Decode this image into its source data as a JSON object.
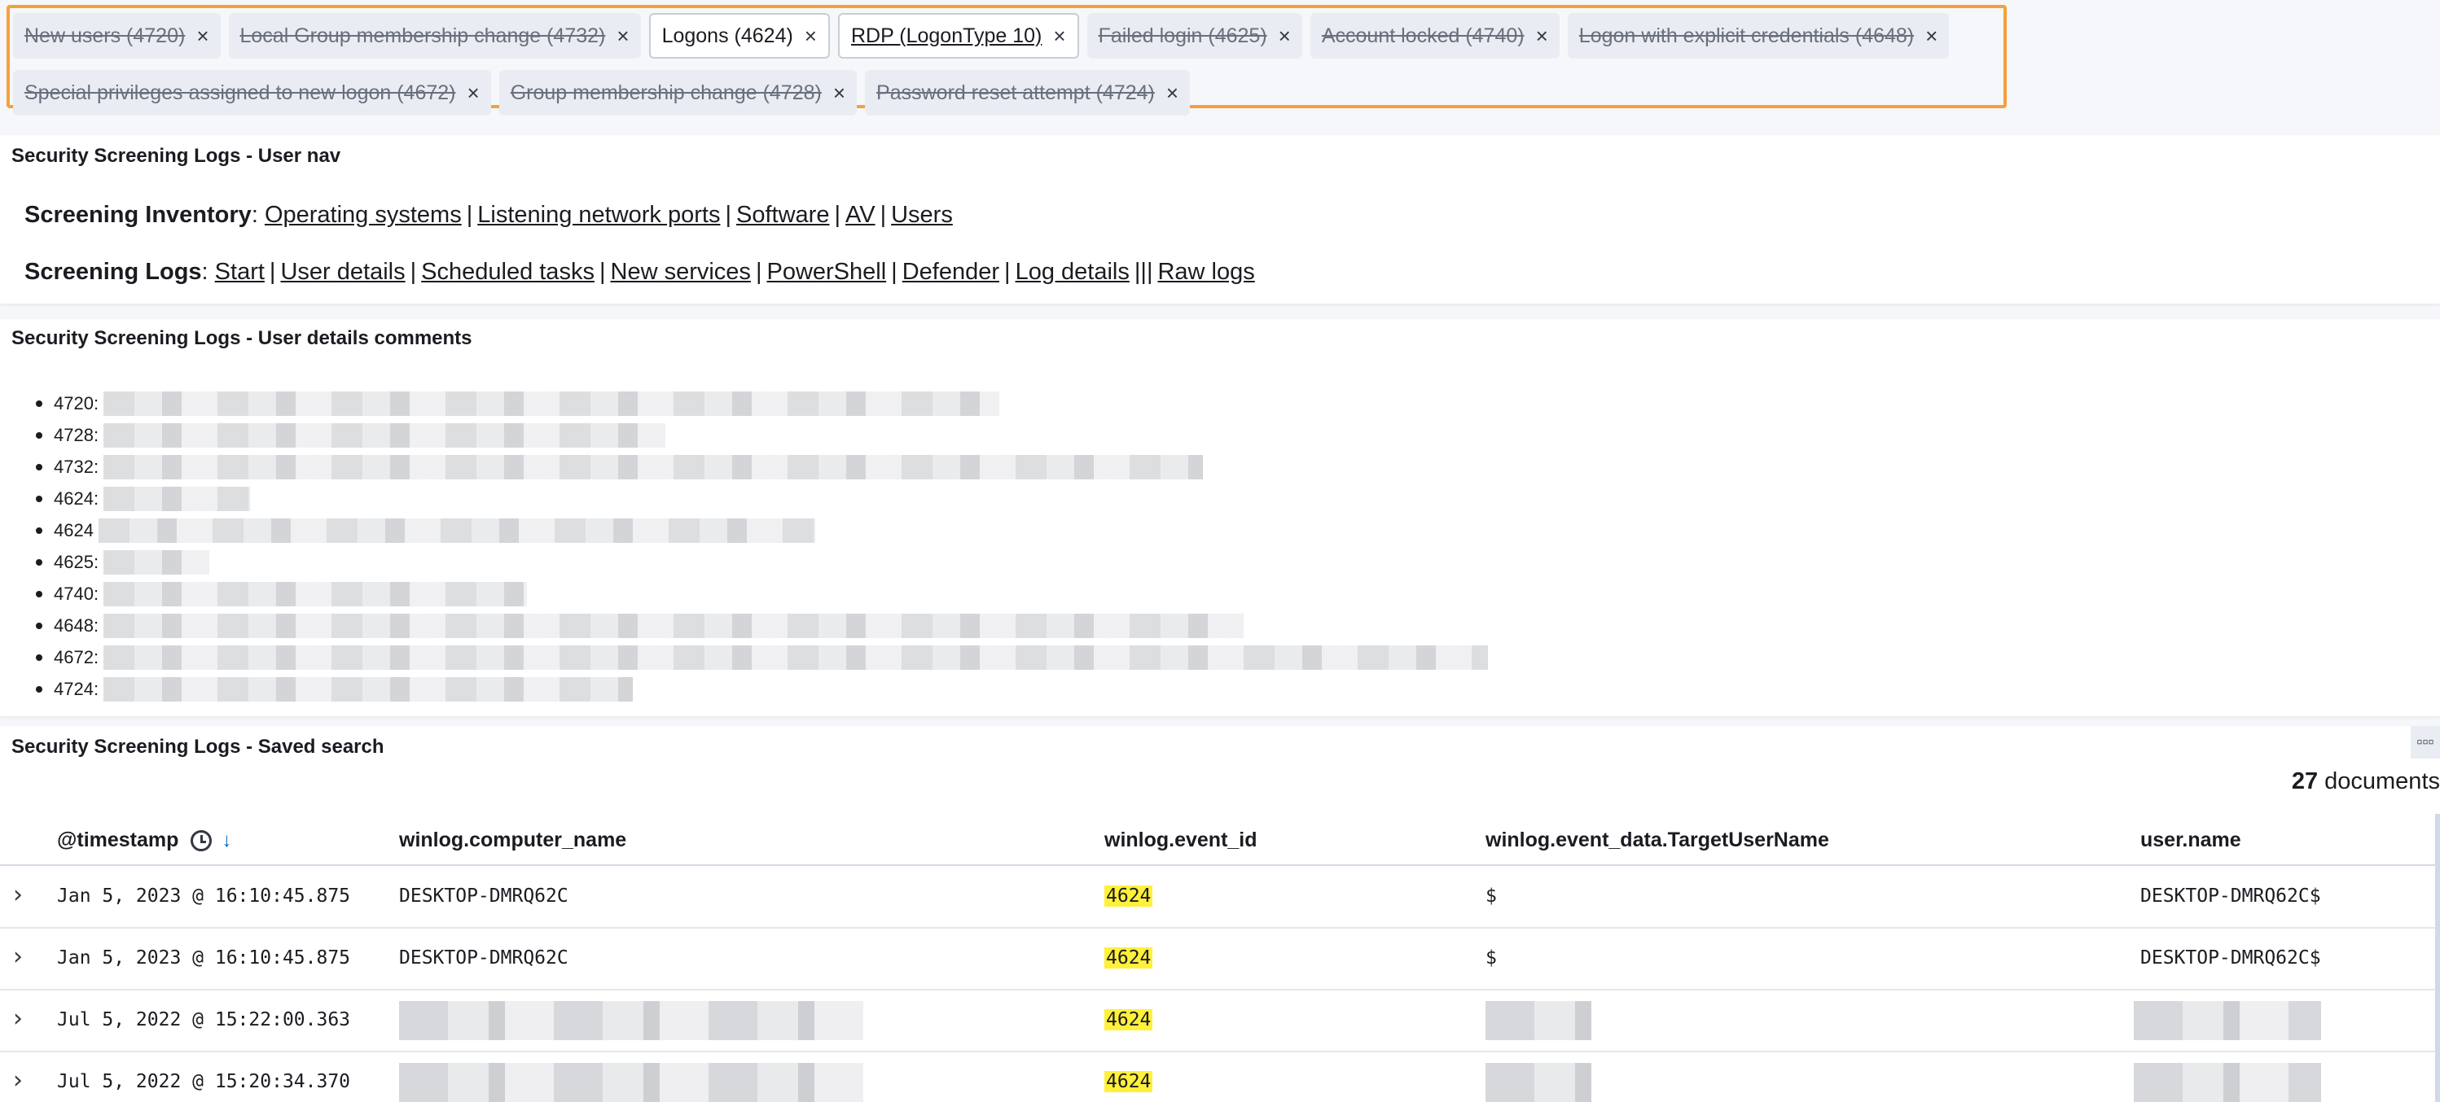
{
  "filters": {
    "row1": [
      {
        "label": "New users (4720)",
        "state": "disabled"
      },
      {
        "label": "Local Group membership change (4732)",
        "state": "disabled"
      },
      {
        "label": "Logons (4624)",
        "state": "active"
      },
      {
        "label": "RDP (LogonType 10)",
        "state": "active-link"
      },
      {
        "label": "Failed login (4625)",
        "state": "disabled"
      },
      {
        "label": "Account locked (4740)",
        "state": "disabled"
      },
      {
        "label": "Logon with explicit credentials (4648)",
        "state": "disabled"
      }
    ],
    "row2": [
      {
        "label": "Special privileges assigned to new logon (4672)",
        "state": "disabled"
      },
      {
        "label": "Group membership change (4728)",
        "state": "disabled"
      },
      {
        "label": "Password reset attempt (4724)",
        "state": "disabled"
      }
    ],
    "close_glyph": "×"
  },
  "nav_panel": {
    "title": "Security Screening Logs - User nav",
    "inventory": {
      "heading": "Screening Inventory",
      "links": [
        "Operating systems",
        "Listening network ports",
        "Software",
        "AV",
        "Users"
      ]
    },
    "logs": {
      "heading": "Screening Logs",
      "links": [
        "Start",
        "User details",
        "Scheduled tasks",
        "New services",
        "PowerShell",
        "Defender",
        "Log details"
      ],
      "extra_separator": "||",
      "last_link": "Raw logs"
    }
  },
  "comments_panel": {
    "title": "Security Screening Logs - User details comments",
    "items": [
      "4720:",
      "4728:",
      "4732:",
      "4624:",
      "4624",
      "4625:",
      "4740:",
      "4648:",
      "4672:",
      "4724:"
    ]
  },
  "search_panel": {
    "title": "Security Screening Logs - Saved search",
    "doc_count": "27",
    "doc_count_label": "documents",
    "columns": {
      "timestamp": "@timestamp",
      "computer": "winlog.computer_name",
      "event_id": "winlog.event_id",
      "target_user": "winlog.event_data.TargetUserName",
      "user": "user.name"
    },
    "rows": [
      {
        "timestamp": "Jan 5, 2023 @ 16:10:45.875",
        "computer": "DESKTOP-DMRQ62C",
        "event_id": "4624",
        "target_user": "$",
        "user": "DESKTOP-DMRQ62C$"
      },
      {
        "timestamp": "Jan 5, 2023 @ 16:10:45.875",
        "computer": "DESKTOP-DMRQ62C",
        "event_id": "4624",
        "target_user": "$",
        "user": "DESKTOP-DMRQ62C$"
      },
      {
        "timestamp": "Jul 5, 2022 @ 15:22:00.363",
        "computer": "",
        "event_id": "4624",
        "target_user": "",
        "user": ""
      },
      {
        "timestamp": "Jul 5, 2022 @ 15:20:34.370",
        "computer": "",
        "event_id": "4624",
        "target_user": "",
        "user": ""
      }
    ],
    "highlight_color": "#fff03a"
  },
  "icons": {
    "pill_close": "close-icon",
    "sort": "clock-icon",
    "sort_dir": "arrow-down-icon",
    "expand": "chevron-right-icon",
    "panel_menu": "ellipsis-icon"
  }
}
